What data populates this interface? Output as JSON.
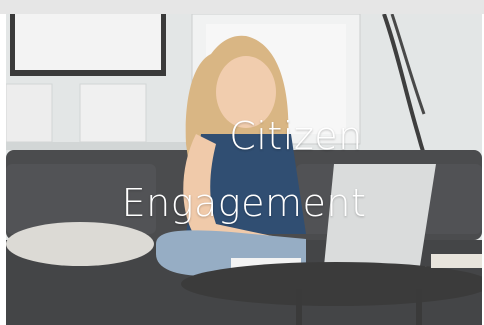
{
  "hero": {
    "title_line1": "Citizen",
    "title_line2": "Engagement",
    "image_subject": "woman-on-sofa-using-laptop"
  },
  "colors": {
    "wall": "#e3e6e6",
    "sofa": "#3b3c3e",
    "text": "#ffffff"
  }
}
